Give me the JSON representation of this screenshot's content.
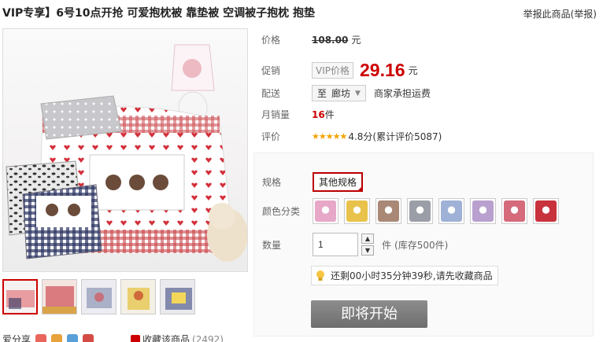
{
  "product": {
    "title": "VIP专享】6号10点开抢 可爱抱枕被 靠垫被 空调被子抱枕 抱垫",
    "report_link": "举报此商品(举报)"
  },
  "price": {
    "label": "价格",
    "original": "108.00",
    "currency_unit": "元"
  },
  "promo": {
    "label": "促销",
    "tag": "VIP价格",
    "price": "29.16",
    "currency_unit": "元"
  },
  "delivery": {
    "label": "配送",
    "prefix": "至",
    "destination": "廊坊",
    "freight": "商家承担运费"
  },
  "sales": {
    "label": "月销量",
    "count": "16",
    "unit": "件"
  },
  "rating": {
    "label": "评价",
    "stars": "★★★★★",
    "text": "4.8分(累计评价5087)"
  },
  "options": {
    "spec_label": "规格",
    "spec_value": "其他规格",
    "color_label": "颜色分类",
    "colors": [
      {
        "icon": "pink-floral-pillow",
        "color": "#e7a8c8"
      },
      {
        "icon": "animal-cartoon-pillow",
        "color": "#e8c24a"
      },
      {
        "icon": "brown-plain-pillow",
        "color": "#a98876"
      },
      {
        "icon": "gray-plain-pillow",
        "color": "#9b9ea6"
      },
      {
        "icon": "blue-pattern-pillow",
        "color": "#9fb1d6"
      },
      {
        "icon": "purple-cartoon-pillow",
        "color": "#b9a0cf"
      },
      {
        "icon": "red-hearts-pillow",
        "color": "#d46a7a"
      },
      {
        "icon": "red-flower-pillow",
        "color": "#c8323c"
      }
    ],
    "qty_label": "数量",
    "qty_value": "1",
    "qty_unit": "件",
    "stock": "(库存500件)",
    "countdown": "还剩00小时35分钟39秒,请先收藏商品",
    "buy_label": "即将开始"
  },
  "share": {
    "label": "爱分享",
    "favorite_label": "收藏该商品",
    "favorite_count": "(2492)"
  }
}
